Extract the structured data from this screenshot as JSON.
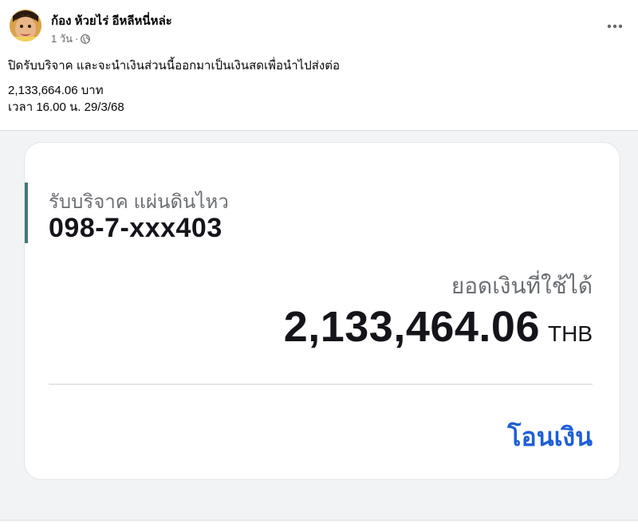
{
  "post": {
    "author": "ก้อง ห้วยไร่ อีหลีหนี่หล่ะ",
    "time": "1 วัน",
    "separator": "·",
    "privacy_icon": "globe-icon",
    "more_icon": "more-horizontal-icon",
    "text": {
      "line1": "ปิดรับบริจาค และจะนำเงินส่วนนี้ออกมาเป็นเงินสดเพื่อนำไปส่งต่อ",
      "line2": "2,133,664.06 บาท",
      "line3": "เวลา 16.00 น. 29/3/68"
    }
  },
  "card": {
    "account_label": "รับบริจาค แผ่นดินไหว",
    "account_number": "098-7-xxx403",
    "balance_label": "ยอดเงินที่ใช้ได้",
    "balance_amount": "2,133,464.06",
    "balance_currency": "THB",
    "transfer_label": "โอนเงิน"
  },
  "colors": {
    "accent_bar": "#3f7a78",
    "transfer_link": "#1f5fd6",
    "muted_text": "#65676b"
  }
}
